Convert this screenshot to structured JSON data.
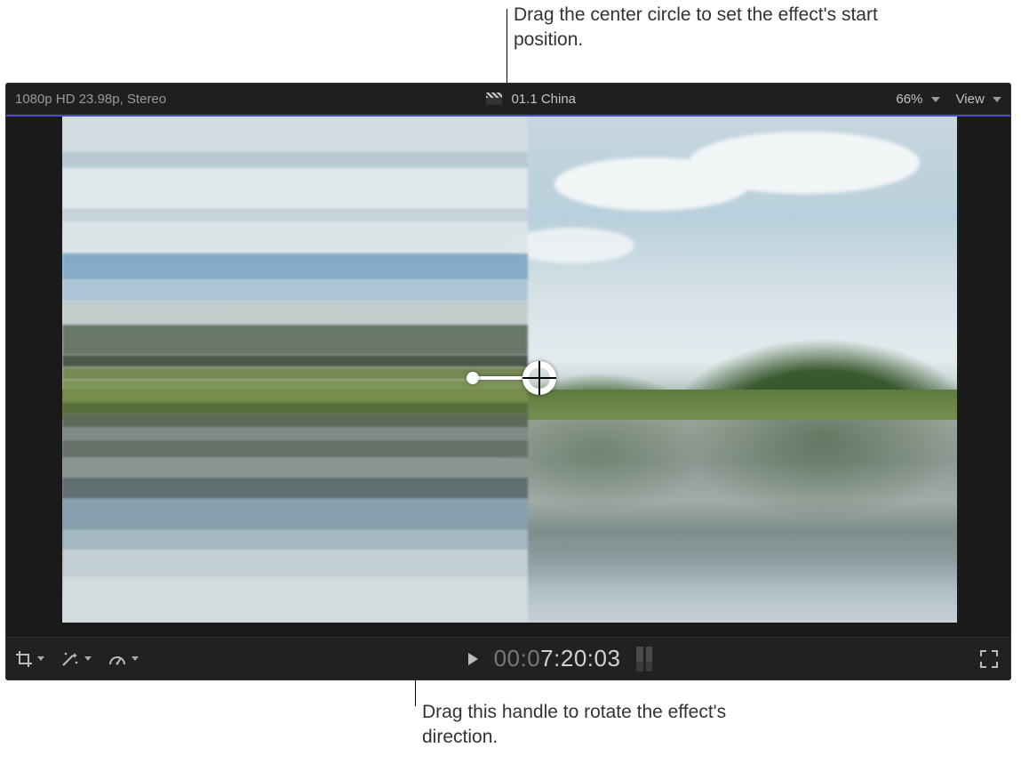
{
  "callouts": {
    "top": "Drag the center circle to set the effect's start position.",
    "bottom": "Drag this handle to rotate the effect's direction."
  },
  "titlebar": {
    "format_info": "1080p HD 23.98p, Stereo",
    "clip_name": "01.1 China",
    "zoom_label": "66%",
    "view_label": "View"
  },
  "transport": {
    "timecode_dim": "00:0",
    "timecode_active": "7:20:03"
  },
  "tools": {
    "crop": "crop",
    "enhance": "enhance",
    "retime": "retime",
    "play": "play",
    "fullscreen": "fullscreen"
  },
  "onscreen_control": {
    "center_ring": "effect-center-handle",
    "rotate_handle": "effect-rotate-handle"
  }
}
